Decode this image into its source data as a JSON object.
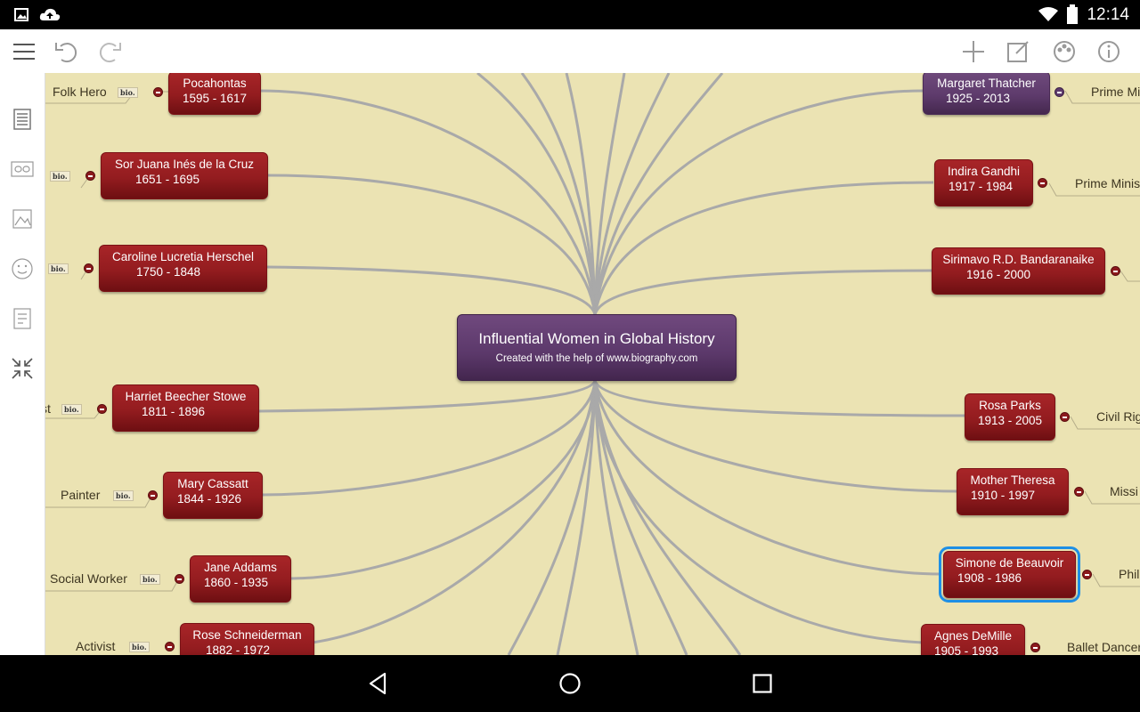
{
  "status": {
    "time": "12:14"
  },
  "toolbar": {
    "left_icons": [
      "menu-icon",
      "undo-icon",
      "redo-icon"
    ],
    "right_icons": [
      "add-icon",
      "edit-icon",
      "palette-icon",
      "info-icon"
    ]
  },
  "sidebar": {
    "icons": [
      "notes-icon",
      "link-icon",
      "image-icon",
      "smiley-icon",
      "task-icon",
      "collapse-all-icon"
    ]
  },
  "map": {
    "title": "Influential Women in Global History",
    "subtitle": "Created with the help of www.biography.com",
    "bio_label": "bio.",
    "nodes": [
      {
        "name": "Pocahontas",
        "years": "1595 - 1617",
        "label": "Folk Hero"
      },
      {
        "name": "Sor Juana Inés de la Cruz",
        "years": "1651 - 1695",
        "label": ""
      },
      {
        "name": "Caroline Lucretia Herschel",
        "years": "1750 - 1848",
        "label": ""
      },
      {
        "name": "Harriet Beecher Stowe",
        "years": "1811 - 1896",
        "label": "st"
      },
      {
        "name": "Mary Cassatt",
        "years": "1844 - 1926",
        "label": "Painter"
      },
      {
        "name": "Jane Addams",
        "years": "1860 - 1935",
        "label": "Social Worker"
      },
      {
        "name": "Rose Schneiderman",
        "years": "1882 - 1972",
        "label": "Activist"
      },
      {
        "name": "Margaret Thatcher",
        "years": "1925 - 2013",
        "label": "Prime Mi"
      },
      {
        "name": "Indira Gandhi",
        "years": "1917 - 1984",
        "label": "Prime Minis"
      },
      {
        "name": "Sirimavo R.D. Bandaranaike",
        "years": "1916 - 2000",
        "label": ""
      },
      {
        "name": "Rosa Parks",
        "years": "1913 - 2005",
        "label": "Civil Rig"
      },
      {
        "name": "Mother Theresa",
        "years": "1910 - 1997",
        "label": "Missi"
      },
      {
        "name": "Simone de Beauvoir",
        "years": "1908 - 1986",
        "label": "Phil"
      },
      {
        "name": "Agnes DeMille",
        "years": "1905 - 1993",
        "label": "Ballet Dancer"
      }
    ]
  },
  "colors": {
    "canvas": "#ebe3b3",
    "node_red": "#931c1f",
    "node_purple": "#5e3b6c",
    "link": "#a9a9a9",
    "selection": "#1e8fe5"
  },
  "navbar": {
    "icons": [
      "back-icon",
      "home-icon",
      "recents-icon"
    ]
  }
}
